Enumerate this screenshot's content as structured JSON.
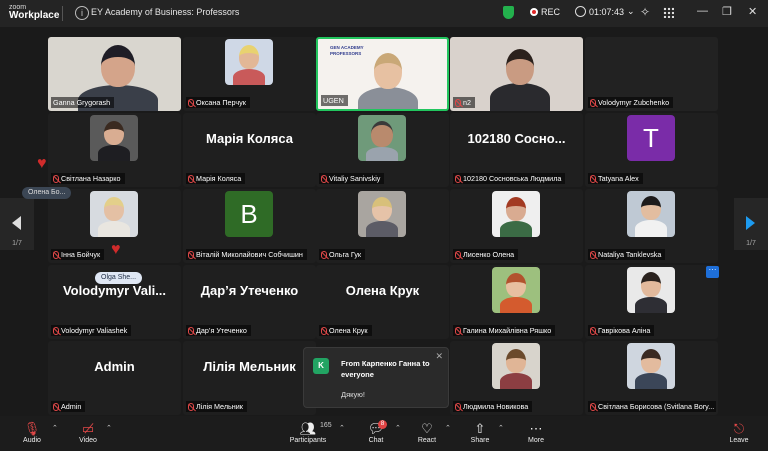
{
  "titlebar": {
    "logo_line1": "zoom",
    "logo_line2": "Workplace",
    "meeting_title": "EY Academy of Business: Professors",
    "rec_label": "REC",
    "timer": "01:07:43"
  },
  "pagination": {
    "left": "1/7",
    "right": "1/7"
  },
  "tiles": {
    "ganna": "Ganna Grygorash",
    "oksana": "Оксана Перчук",
    "ugen": "UGEN",
    "ugen_slide": "GEN ACADEMY PROFESSORS",
    "n2": "n2",
    "zubchenko": "Volodymyr Zubchenko",
    "nazarko": "Світлана Назарко",
    "koliasa_big": "Марія Коляса",
    "koliasa": "Марія Коляса",
    "vitaliy": "Vitaliy Sanivskiy",
    "sosnovska_big": "102180 Сосно...",
    "sosnovska": "102180 Сосновська Людмила",
    "tatyana": "Tatyana Alex",
    "tatyana_letter": "T",
    "boichuk": "Інна Бойчук",
    "sobchyshyn": "Віталій Миколайович Собчишин",
    "sobchyshyn_letter": "B",
    "guk": "Ольга Гук",
    "lysenko": "Лисенко Олена",
    "tanklevska": "Nataliya Tanklevska",
    "valiashek_big": "Volodymyr Vali...",
    "valiashek": "Volodymyr Valiashek",
    "utechenko_big": "Дар’я Утеченко",
    "utechenko": "Дар’я Утеченко",
    "kruk_big": "Олена Крук",
    "kruk": "Олена Крук",
    "riashko": "Галина Михайлівна Ряшко",
    "gavrikova": "Гаврікова Аліна",
    "admin_big": "Admin",
    "admin": "Admin",
    "melnyk_big": "Лілія Мельник",
    "melnyk": "Лілія Мельник",
    "novikova": "Людмила Новикова",
    "borysova": "Світлана Борисова (Svitlana Bory..."
  },
  "floating": {
    "olena_label": "Олена Бо...",
    "olga_label": "Olga She..."
  },
  "toast": {
    "avatar_letter": "K",
    "from": "From Карпенко Ганна to everyone",
    "message": "Дякую!"
  },
  "toolbar": {
    "audio": "Audio",
    "video": "Video",
    "participants": "Participants",
    "participants_count": "165",
    "chat": "Chat",
    "chat_badge": "8",
    "react": "React",
    "share": "Share",
    "more": "More",
    "leave": "Leave"
  }
}
